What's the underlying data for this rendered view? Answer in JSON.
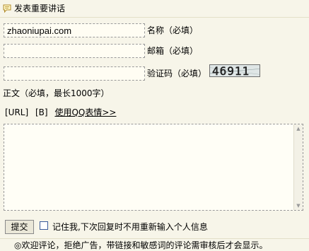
{
  "header": {
    "title": "发表重要讲话",
    "icon": "comment-icon"
  },
  "form": {
    "name": {
      "value": "zhaoniupai.com",
      "label": "名称（必填）"
    },
    "email": {
      "value": "",
      "label": "邮箱（必填）"
    },
    "captcha": {
      "value": "",
      "label": "验证码（必填）",
      "image_text": "46911"
    },
    "body": {
      "label": "正文（必填，最长1000字）",
      "value": ""
    },
    "tools": {
      "url": "[URL]",
      "bold": "[B]",
      "qq_emoji": "使用QQ表情>>"
    },
    "submit_label": "提交",
    "remember": {
      "checked": false,
      "label": "记住我,下次回复时不用重新输入个人信息"
    }
  },
  "footer": {
    "note": "◎欢迎评论，拒绝广告，带链接和敏感词的评论需审核后才会显示。"
  }
}
